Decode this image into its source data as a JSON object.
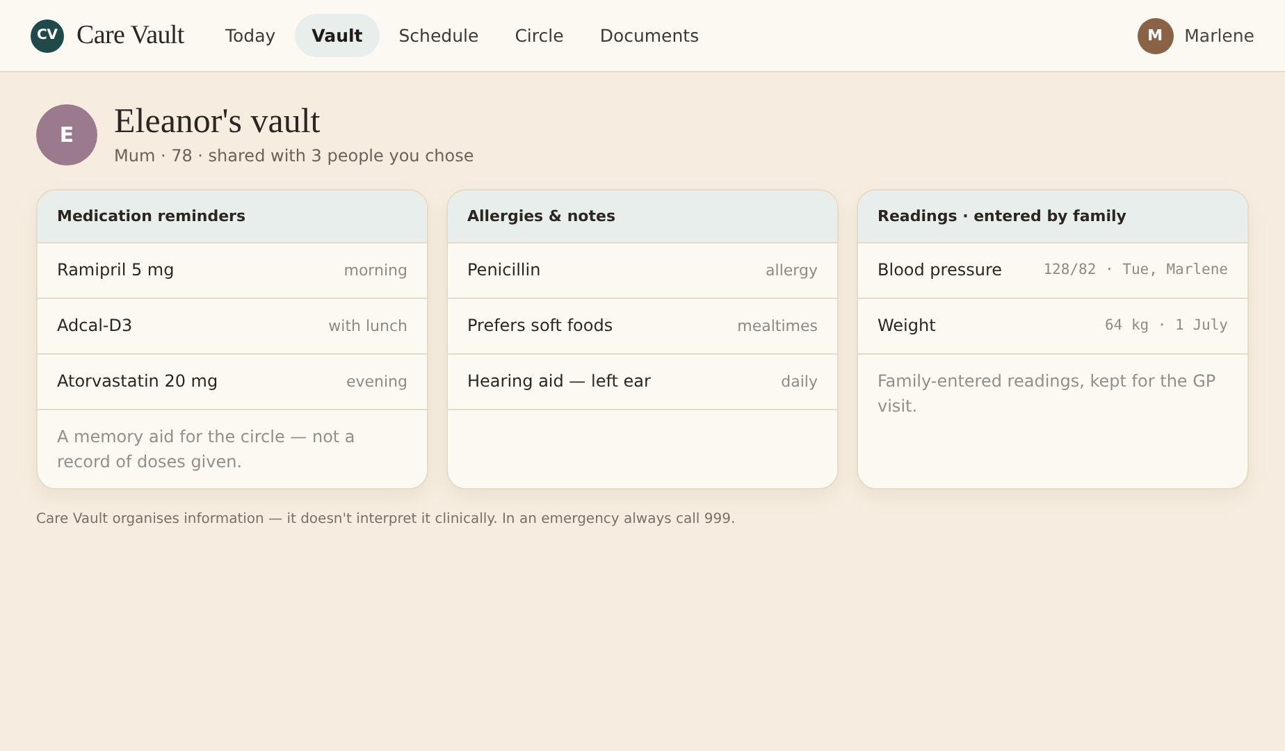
{
  "app": {
    "logo_mark": "CV",
    "name": "Care Vault"
  },
  "nav": [
    {
      "label": "Today",
      "selected": false
    },
    {
      "label": "Vault",
      "selected": true
    },
    {
      "label": "Schedule",
      "selected": false
    },
    {
      "label": "Circle",
      "selected": false
    },
    {
      "label": "Documents",
      "selected": false
    }
  ],
  "user": {
    "initial": "M",
    "name": "Marlene"
  },
  "profile": {
    "initial": "E",
    "title": "Eleanor's vault",
    "subtitle": "Mum · 78 · shared with 3 people you chose"
  },
  "cards": [
    {
      "title": "Medication reminders",
      "kind": "text",
      "rows": [
        {
          "label": "Ramipril 5 mg",
          "value": "morning"
        },
        {
          "label": "Adcal-D3",
          "value": "with lunch"
        },
        {
          "label": "Atorvastatin 20 mg",
          "value": "evening"
        }
      ],
      "note": "A memory aid for the circle — not a record of doses given."
    },
    {
      "title": "Allergies & notes",
      "kind": "text",
      "rows": [
        {
          "label": "Penicillin",
          "value": "allergy"
        },
        {
          "label": "Prefers soft foods",
          "value": "mealtimes"
        },
        {
          "label": "Hearing aid — left ear",
          "value": "daily"
        }
      ]
    },
    {
      "title": "Readings · entered by family",
      "kind": "reading",
      "rows": [
        {
          "label": "Blood pressure",
          "value": "128/82 · Tue, Marlene"
        },
        {
          "label": "Weight",
          "value": "64 kg · 1 July"
        }
      ],
      "note": "Family-entered readings, kept for the GP visit."
    }
  ],
  "footer": "Care Vault organises information — it doesn't interpret it clinically. In an emergency always call 999."
}
